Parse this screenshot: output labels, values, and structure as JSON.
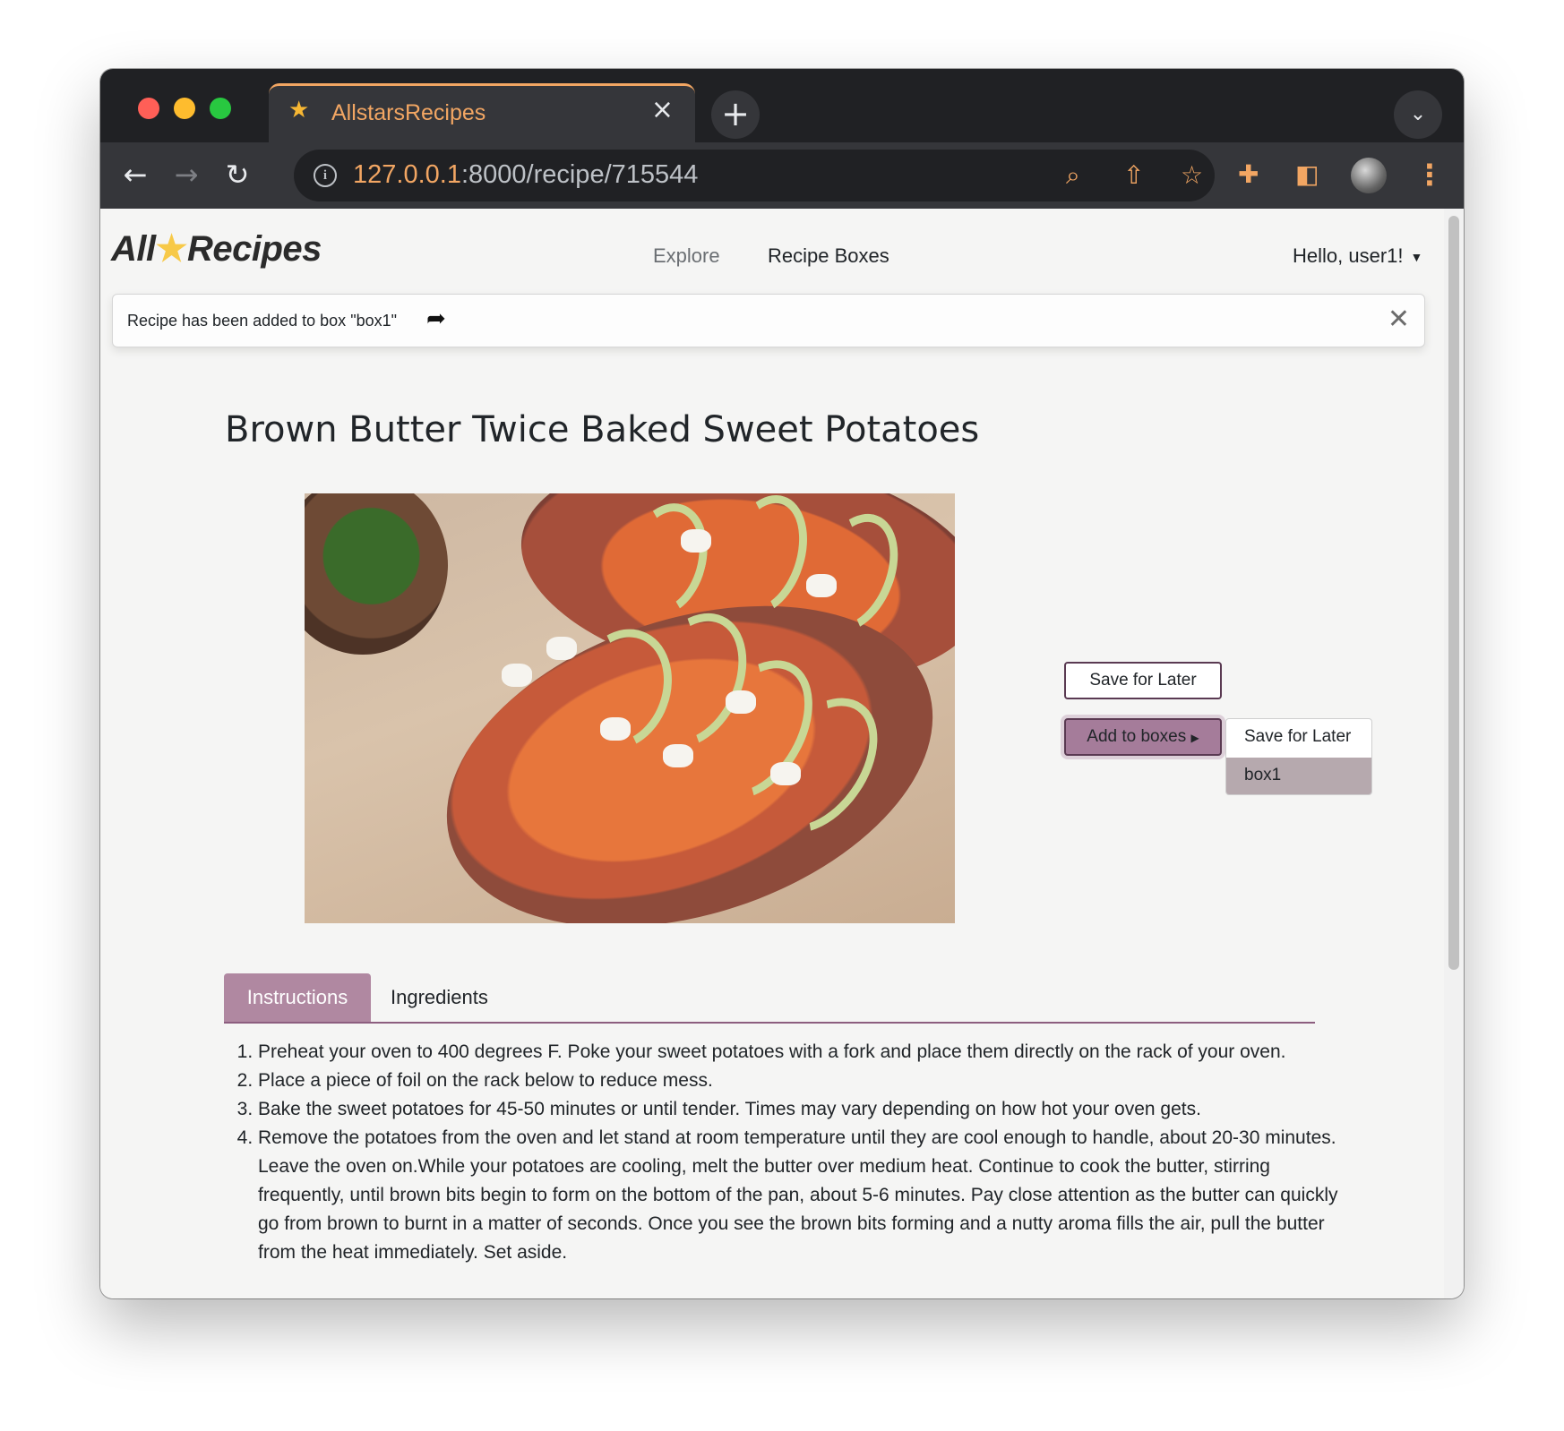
{
  "browser": {
    "tab_title": "AllstarsRecipes",
    "url_host": "127.0.0.1",
    "url_path": ":8000/recipe/715544"
  },
  "site": {
    "brand_left": "All",
    "brand_right": "Recipes",
    "nav": {
      "explore": "Explore",
      "recipe_boxes": "Recipe Boxes"
    },
    "user_greeting": "Hello, user1!"
  },
  "alert": {
    "message": "Recipe has been added to box \"box1\""
  },
  "recipe": {
    "title": "Brown Butter Twice Baked Sweet Potatoes",
    "save_button": "Save for Later",
    "add_button": "Add to boxes",
    "box_menu": [
      "Save for Later",
      "box1"
    ],
    "tabs": {
      "instructions": "Instructions",
      "ingredients": "Ingredients"
    },
    "steps": [
      "Preheat your oven to 400 degrees F. Poke your sweet potatoes with a fork and place them directly on the rack of your oven.",
      "Place a piece of foil on the rack below to reduce mess.",
      "Bake the sweet potatoes for 45-50 minutes or until tender. Times may vary depending on how hot your oven gets.",
      "Remove the potatoes from the oven and let stand at room temperature until they are cool enough to handle, about 20-30 minutes. Leave the oven on.While your potatoes are cooling, melt the butter over medium heat. Continue to cook the butter, stirring frequently, until brown bits begin to form on the bottom of the pan, about 5-6 minutes. Pay close attention as the butter can quickly go from brown to burnt in a matter of seconds. Once you see the brown bits forming and a nutty aroma fills the air, pull the butter from the heat immediately. Set aside."
    ]
  },
  "colors": {
    "accent": "#b088a1",
    "accent_dark": "#5a3a52",
    "browser_accent": "#f2a663"
  }
}
